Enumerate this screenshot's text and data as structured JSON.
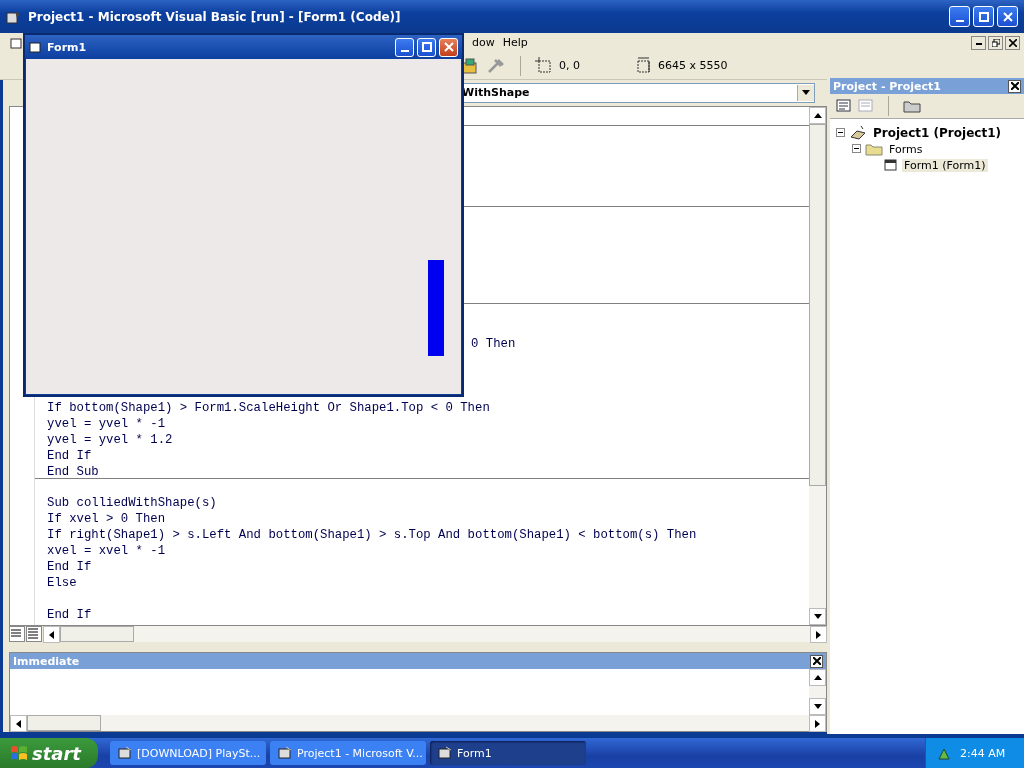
{
  "window": {
    "title": "Project1 - Microsoft Visual Basic [run] - [Form1 (Code)]"
  },
  "menu": [
    "dow",
    "Help"
  ],
  "toolbar": {
    "position": "0, 0",
    "size": "6645 x 5550"
  },
  "code_window": {
    "procedure": "WithShape",
    "sections": [
      {
        "lines": [
          {
            "text": "0 Then",
            "kind": "covered"
          },
          {
            "text": "If bottom(Shape1) > Form1.ScaleHeight Or Shape1.Top < 0 Then",
            "kind": "code"
          },
          {
            "text": "yvel = yvel * -1",
            "kind": "code"
          },
          {
            "text": "yvel = yvel * 1.2",
            "kind": "code"
          },
          {
            "text": "End If",
            "kind": "code"
          },
          {
            "text": "End Sub",
            "kind": "code"
          }
        ]
      },
      {
        "lines": [
          {
            "text": "Sub colliedWithShape(s)",
            "kind": "code"
          },
          {
            "text": "If xvel > 0 Then",
            "kind": "code"
          },
          {
            "text": "If right(Shape1) > s.Left And bottom(Shape1) > s.Top And bottom(Shape1) < bottom(s) Then",
            "kind": "code"
          },
          {
            "text": "xvel = xvel * -1",
            "kind": "code"
          },
          {
            "text": "End If",
            "kind": "code"
          },
          {
            "text": "Else",
            "kind": "code"
          },
          {
            "kind": "blank"
          },
          {
            "text": "End If",
            "kind": "code"
          }
        ]
      }
    ]
  },
  "immediate": {
    "title": "Immediate"
  },
  "project": {
    "title": "Project - Project1",
    "tree": [
      {
        "label": "Project1 (Project1)",
        "expanded": true,
        "selected": false,
        "children": [
          {
            "label": "Forms",
            "expanded": true,
            "selected": false,
            "children": [
              {
                "label": "Form1 (Form1)",
                "selected": true
              }
            ]
          }
        ]
      }
    ]
  },
  "form_window": {
    "title": "Form1"
  },
  "taskbar": {
    "start": "start",
    "items": [
      {
        "label": "[DOWNLOAD] PlaySt...",
        "selected": false
      },
      {
        "label": "Project1 - Microsoft V...",
        "selected": false
      },
      {
        "label": "Form1",
        "selected": true
      }
    ],
    "clock": "2:44 AM"
  }
}
